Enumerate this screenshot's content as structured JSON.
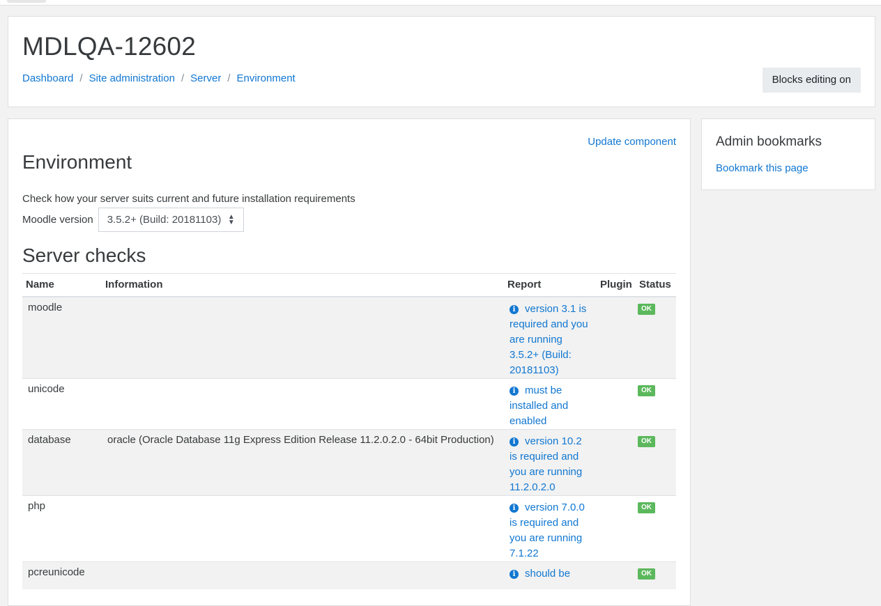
{
  "header": {
    "title": "MDLQA-12602",
    "breadcrumb": [
      "Dashboard",
      "Site administration",
      "Server",
      "Environment"
    ],
    "separator": "/",
    "blocks_button": "Blocks editing on"
  },
  "main": {
    "update_link": "Update component",
    "heading": "Environment",
    "description": "Check how your server suits current and future installation requirements",
    "version_label": "Moodle version",
    "version_selected": "3.5.2+ (Build: 20181103)",
    "server_checks_heading": "Server checks",
    "columns": [
      "Name",
      "Information",
      "Report",
      "Plugin",
      "Status"
    ],
    "rows": [
      {
        "name": "moodle",
        "info": "",
        "report": [
          "version 3.1 is",
          "required and you",
          "are running",
          "3.5.2+ (Build:",
          "20181103)"
        ],
        "status": "OK"
      },
      {
        "name": "unicode",
        "info": "",
        "report": [
          "must be",
          "installed and",
          "enabled"
        ],
        "status": "OK"
      },
      {
        "name": "database",
        "info": "oracle (Oracle Database 11g Express Edition Release 11.2.0.2.0 - 64bit Production)",
        "report": [
          "version 10.2",
          "is required and",
          "you are running",
          "11.2.0.2.0"
        ],
        "status": "OK"
      },
      {
        "name": "php",
        "info": "",
        "report": [
          "version 7.0.0",
          "is required and",
          "you are running",
          "7.1.22"
        ],
        "status": "OK"
      },
      {
        "name": "pcreunicode",
        "info": "",
        "report": [
          "should be"
        ],
        "status": "OK"
      }
    ],
    "colors": {
      "link": "#1177d1",
      "ok": "#5cb85c"
    }
  },
  "sidebar": {
    "title": "Admin bookmarks",
    "link": "Bookmark this page"
  }
}
